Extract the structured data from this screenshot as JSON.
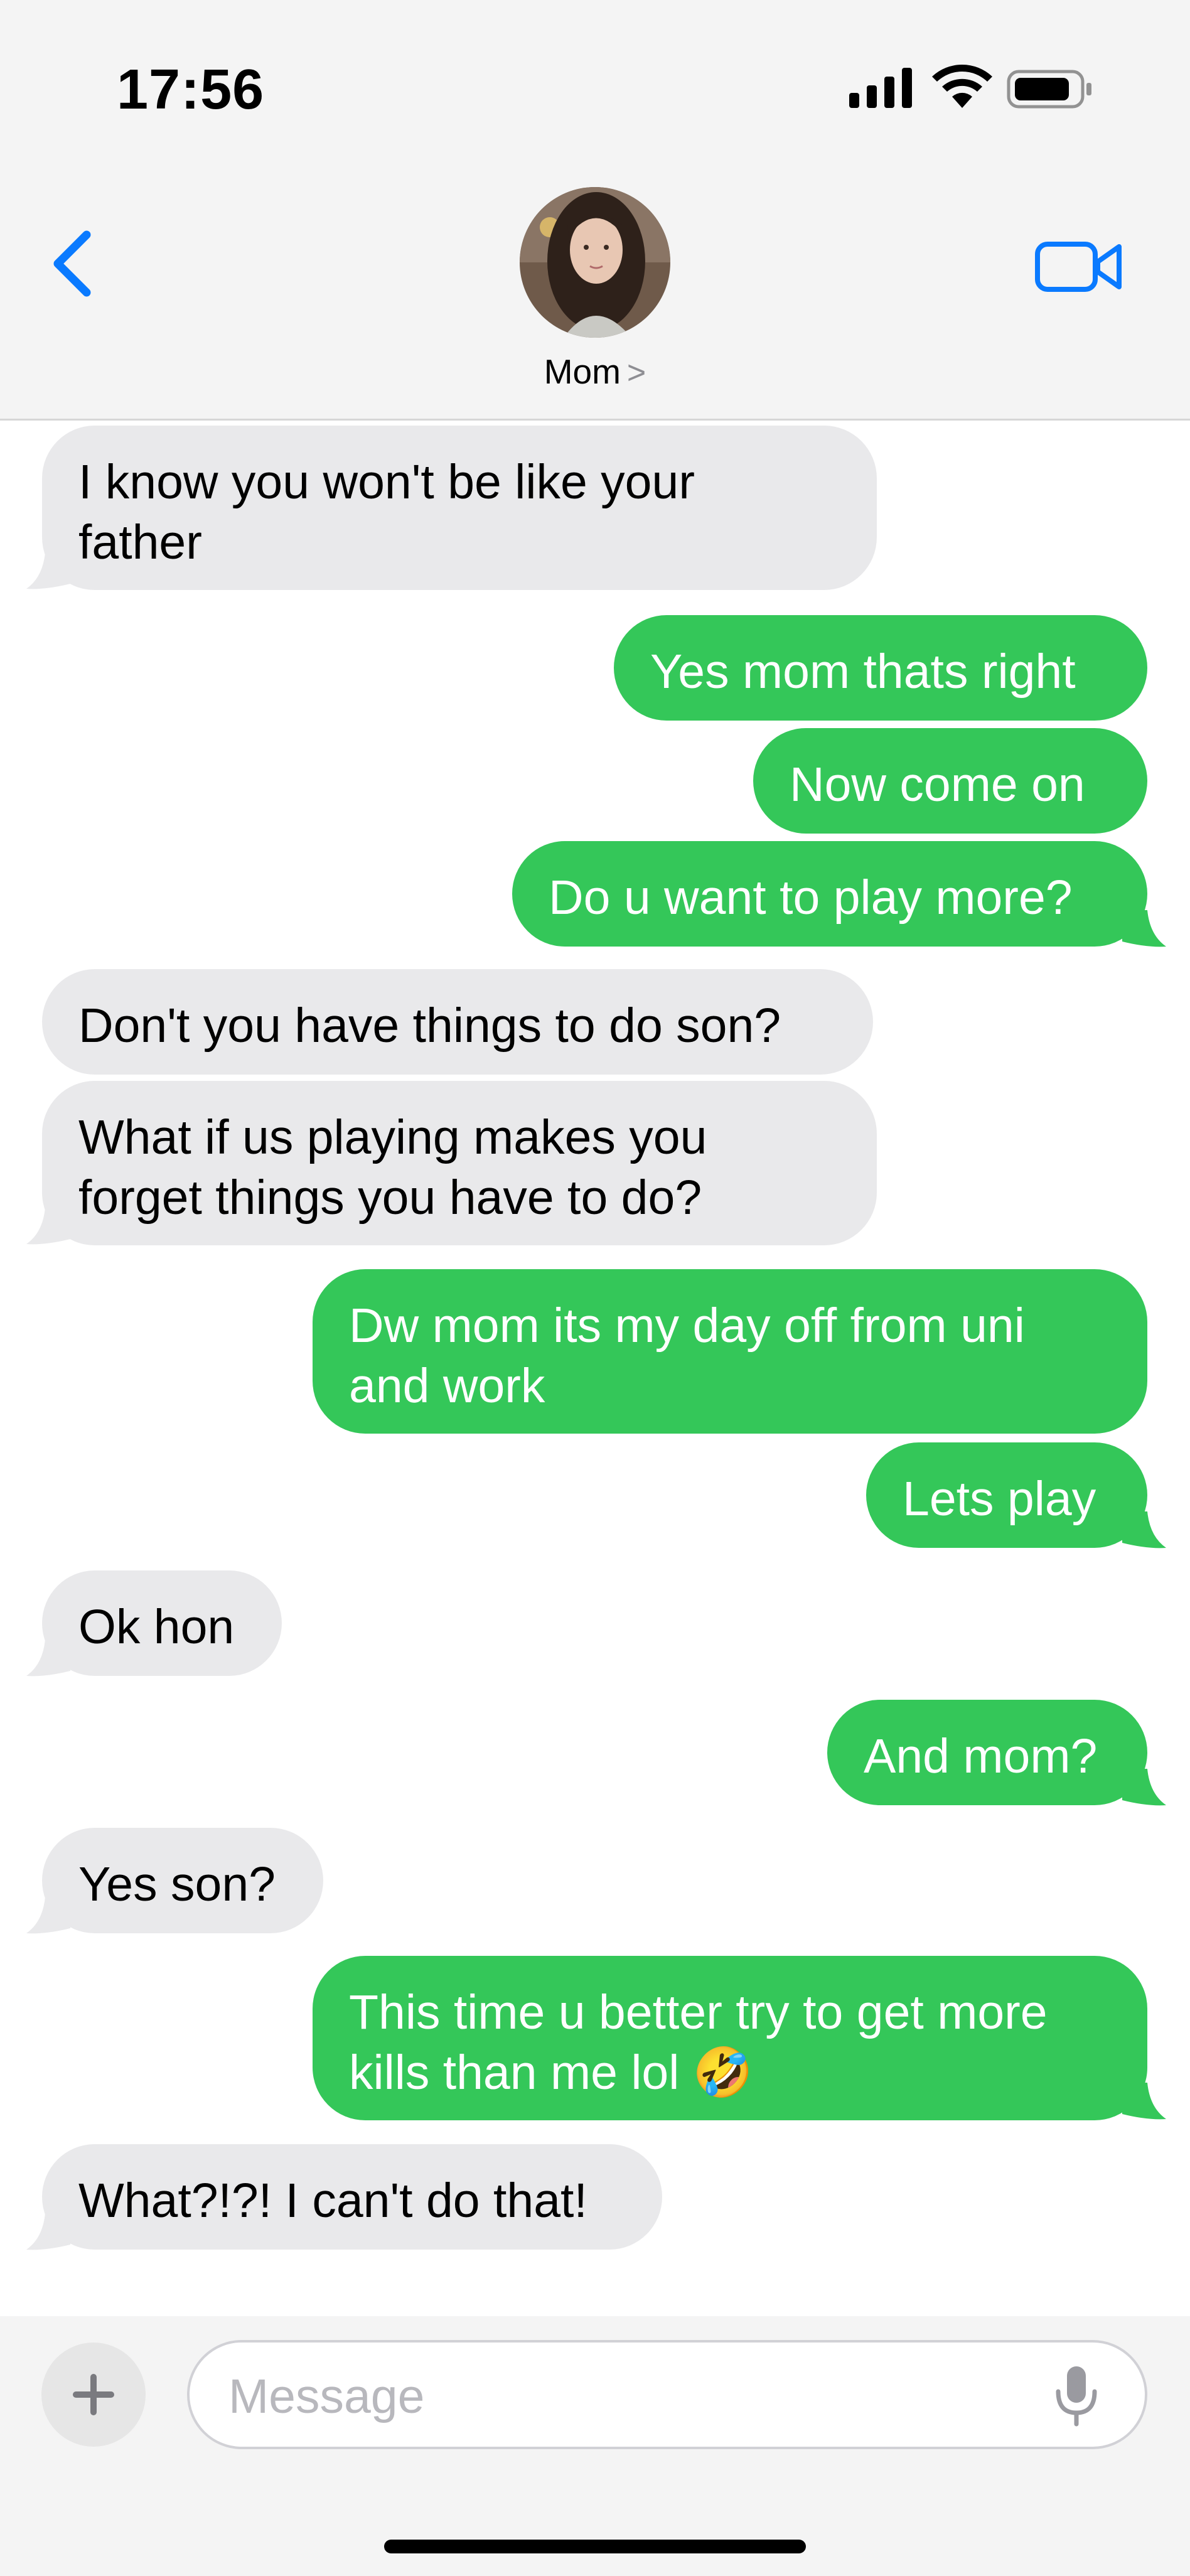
{
  "status_bar": {
    "time": "17:56",
    "signal_icon": "cellular-signal-icon",
    "wifi_icon": "wifi-icon",
    "battery_icon": "battery-icon"
  },
  "header": {
    "back_icon": "chevron-left-icon",
    "contact_name": "Mom",
    "contact_chevron": ">",
    "video_icon": "video-camera-icon",
    "avatar_icon": "contact-avatar"
  },
  "colors": {
    "sent_bubble": "#34c759",
    "received_bubble": "#e9e9eb",
    "accent": "#0a7aff"
  },
  "messages": [
    {
      "from": "mom",
      "lines": [
        "I know you won't be like your",
        "father"
      ]
    },
    {
      "from": "me",
      "lines": [
        "Yes mom thats right"
      ]
    },
    {
      "from": "me",
      "lines": [
        "Now come on"
      ]
    },
    {
      "from": "me",
      "lines": [
        "Do u want to play more?"
      ]
    },
    {
      "from": "mom",
      "lines": [
        "Don't you have things to do son?"
      ]
    },
    {
      "from": "mom",
      "lines": [
        "What if us playing makes you",
        "forget things you have to do?"
      ]
    },
    {
      "from": "me",
      "lines": [
        "Dw mom its my day off from uni",
        "and work"
      ]
    },
    {
      "from": "me",
      "lines": [
        "Lets play"
      ]
    },
    {
      "from": "mom",
      "lines": [
        "Ok hon"
      ]
    },
    {
      "from": "me",
      "lines": [
        "And mom?"
      ]
    },
    {
      "from": "mom",
      "lines": [
        "Yes son?"
      ]
    },
    {
      "from": "me",
      "lines": [
        "This time u better try to get more",
        "kills than me lol 🤣"
      ]
    },
    {
      "from": "mom",
      "lines": [
        "What?!?! I can't do that!"
      ]
    }
  ],
  "composer": {
    "plus_icon": "plus-icon",
    "placeholder": "Message",
    "mic_icon": "microphone-icon"
  }
}
